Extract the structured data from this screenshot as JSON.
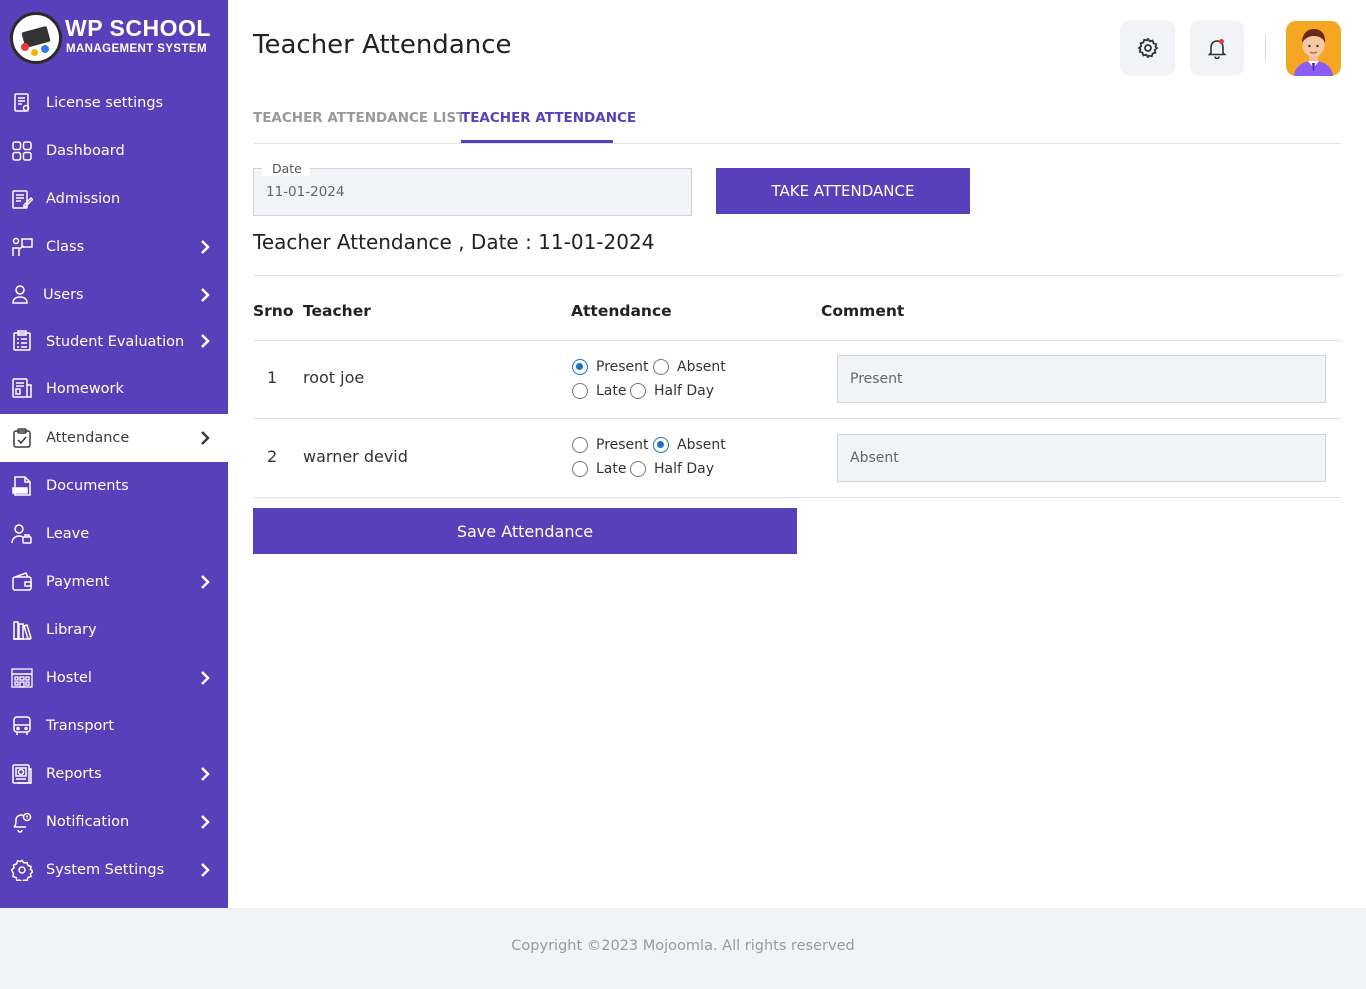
{
  "brand": {
    "title": "WP SCHOOL",
    "subtitle": "MANAGEMENT SYSTEM"
  },
  "sidebar": {
    "items": [
      {
        "label": "License settings",
        "icon": "license-icon",
        "has_children": false,
        "active": false
      },
      {
        "label": "Dashboard",
        "icon": "dashboard-icon",
        "has_children": false,
        "active": false
      },
      {
        "label": "Admission",
        "icon": "admission-icon",
        "has_children": false,
        "active": false
      },
      {
        "label": "Class",
        "icon": "class-icon",
        "has_children": true,
        "active": false
      },
      {
        "label": "Users",
        "icon": "users-icon",
        "has_children": true,
        "active": false
      },
      {
        "label": "Student Evaluation",
        "icon": "evaluation-icon",
        "has_children": true,
        "active": false
      },
      {
        "label": "Homework",
        "icon": "homework-icon",
        "has_children": false,
        "active": false
      },
      {
        "label": "Attendance",
        "icon": "attendance-icon",
        "has_children": true,
        "active": true
      },
      {
        "label": "Documents",
        "icon": "documents-icon",
        "has_children": false,
        "active": false
      },
      {
        "label": "Leave",
        "icon": "leave-icon",
        "has_children": false,
        "active": false
      },
      {
        "label": "Payment",
        "icon": "payment-icon",
        "has_children": true,
        "active": false
      },
      {
        "label": "Library",
        "icon": "library-icon",
        "has_children": false,
        "active": false
      },
      {
        "label": "Hostel",
        "icon": "hostel-icon",
        "has_children": true,
        "active": false
      },
      {
        "label": "Transport",
        "icon": "transport-icon",
        "has_children": false,
        "active": false
      },
      {
        "label": "Reports",
        "icon": "reports-icon",
        "has_children": true,
        "active": false
      },
      {
        "label": "Notification",
        "icon": "notification-icon",
        "has_children": true,
        "active": false
      },
      {
        "label": "System Settings",
        "icon": "settings-icon",
        "has_children": true,
        "active": false
      }
    ]
  },
  "header": {
    "title": "Teacher Attendance",
    "settings_icon": "gear-icon",
    "notification_icon": "bell-icon",
    "avatar_icon": "user-avatar"
  },
  "tabs": [
    {
      "label": "TEACHER ATTENDANCE LIST",
      "active": false
    },
    {
      "label": "TEACHER ATTENDANCE",
      "active": true
    }
  ],
  "form": {
    "date_label": "Date",
    "date_value": "11-01-2024",
    "take_button": "TAKE ATTENDANCE"
  },
  "attendance": {
    "heading": "Teacher Attendance , Date : 11-01-2024",
    "columns": [
      "Srno",
      "Teacher",
      "Attendance",
      "Comment"
    ],
    "options": [
      "Present",
      "Absent",
      "Late",
      "Half Day"
    ],
    "rows": [
      {
        "srno": "1",
        "teacher": "root joe",
        "selected": "Present",
        "comment": "Present"
      },
      {
        "srno": "2",
        "teacher": "warner devid",
        "selected": "Absent",
        "comment": "Absent"
      }
    ],
    "save_button": "Save Attendance"
  },
  "footer": {
    "text": "Copyright ©2023 Mojoomla. All rights reserved"
  },
  "colors": {
    "primary": "#5840bb",
    "radio_selected": "#1a73c9",
    "input_bg": "#f1f3f7",
    "avatar_bg": "#f5a623"
  }
}
